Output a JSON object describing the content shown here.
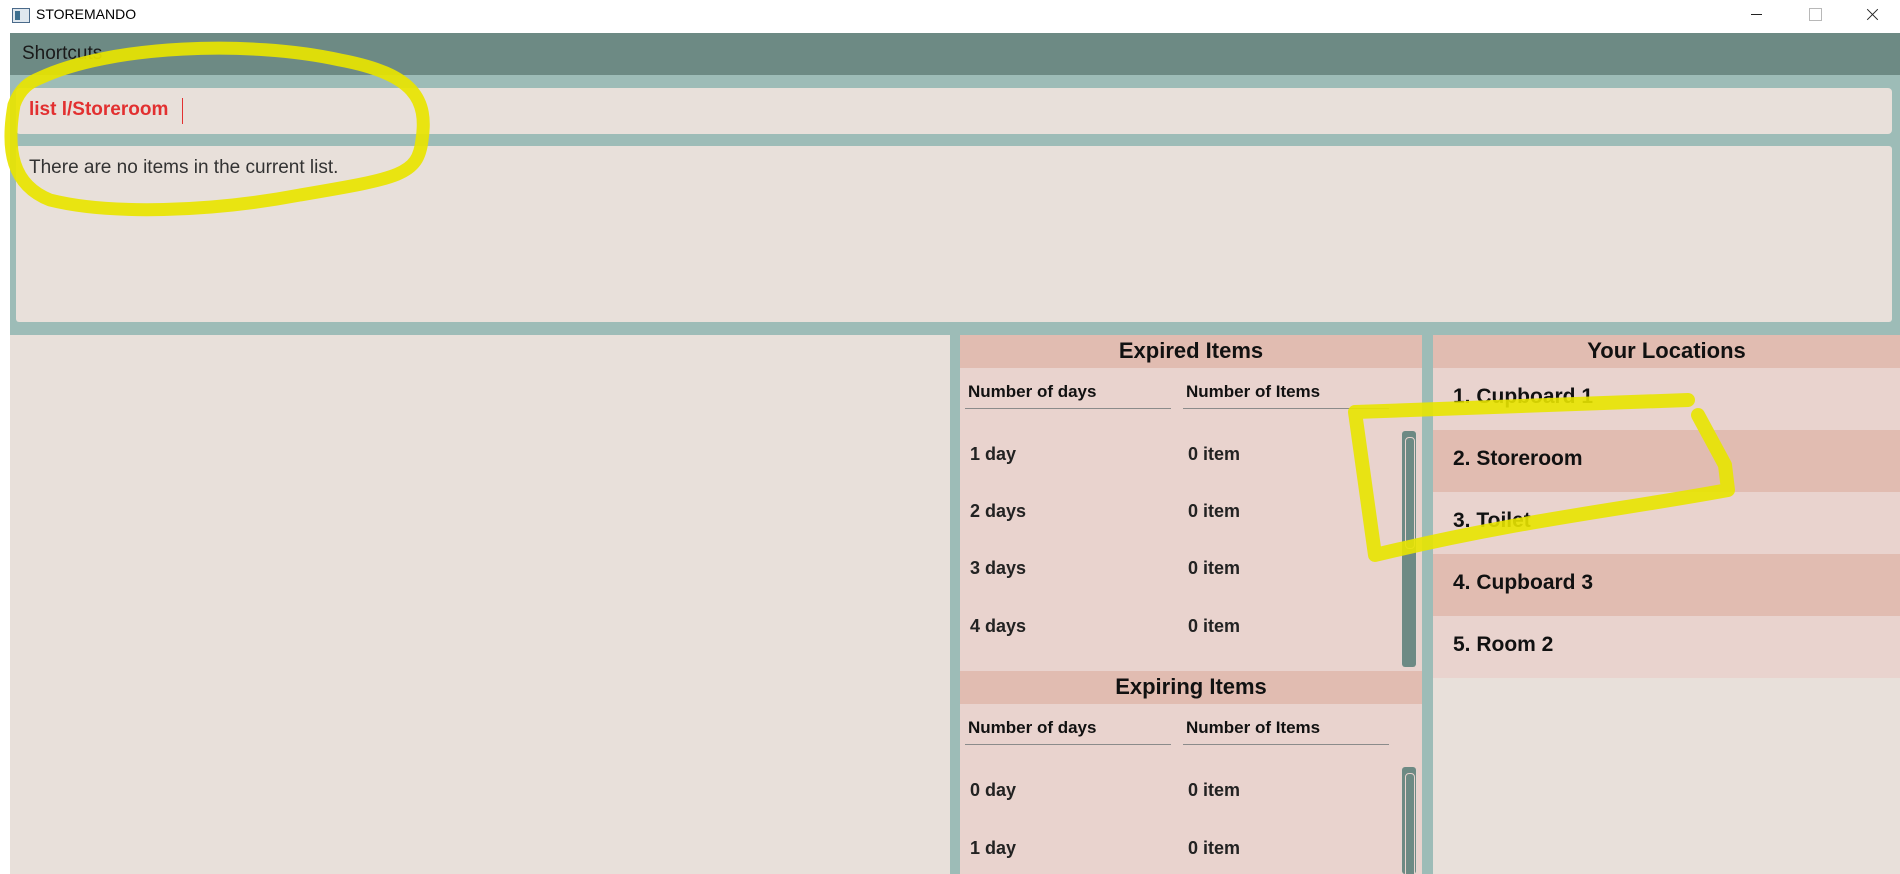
{
  "window": {
    "title": "STOREMANDO"
  },
  "menu": {
    "shortcuts_label": "Shortcuts"
  },
  "command": {
    "value": "list l/Storeroom"
  },
  "result": {
    "text": "There are no items in the current list."
  },
  "expired": {
    "title": "Expired Items",
    "col_days": "Number of days",
    "col_items": "Number of Items",
    "rows": [
      {
        "days": "1 day",
        "items": "0 item"
      },
      {
        "days": "2 days",
        "items": "0 item"
      },
      {
        "days": "3 days",
        "items": "0 item"
      },
      {
        "days": "4 days",
        "items": "0 item"
      }
    ]
  },
  "expiring": {
    "title": "Expiring Items",
    "col_days": "Number of days",
    "col_items": "Number of Items",
    "rows": [
      {
        "days": "0 day",
        "items": "0 item"
      },
      {
        "days": "1 day",
        "items": "0 item"
      }
    ]
  },
  "locations": {
    "title": "Your Locations",
    "items": [
      {
        "label": "1. Cupboard 1"
      },
      {
        "label": "2. Storeroom"
      },
      {
        "label": "3. Toilet"
      },
      {
        "label": "4. Cupboard 3"
      },
      {
        "label": "5. Room 2"
      }
    ]
  },
  "colors": {
    "highlighter": "#e8e400",
    "accent_dark": "#6d8a84",
    "background": "#9dbcb7",
    "command_text": "#e23030"
  }
}
